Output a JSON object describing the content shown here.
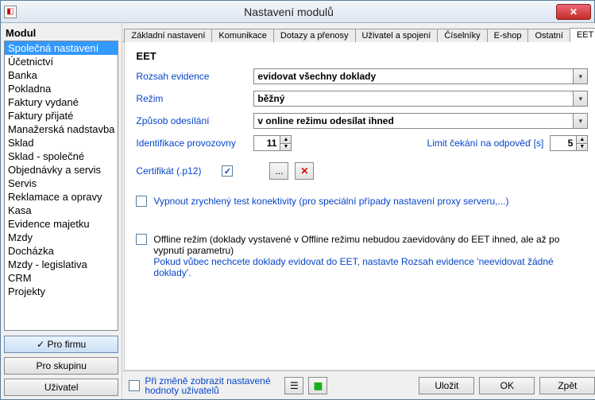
{
  "window": {
    "title": "Nastavení modulů"
  },
  "sidebar": {
    "heading": "Modul",
    "items": [
      "Společná nastavení",
      "Účetnictví",
      "Banka",
      "Pokladna",
      "Faktury vydané",
      "Faktury přijaté",
      "Manažerská nadstavba",
      "Sklad",
      "Sklad - společné",
      "Objednávky a servis",
      "Servis",
      "Reklamace a opravy",
      "Kasa",
      "Evidence majetku",
      "Mzdy",
      "Docházka",
      "Mzdy - legislativa",
      "CRM",
      "Projekty"
    ],
    "selected_index": 0,
    "buttons": {
      "firm": "✓ Pro firmu",
      "group": "Pro skupinu",
      "user": "Uživatel"
    }
  },
  "tabs": [
    "Základní nastavení",
    "Komunikace",
    "Dotazy a přenosy",
    "Uživatel a spojení",
    "Číselníky",
    "E-shop",
    "Ostatní",
    "EET"
  ],
  "active_tab_index": 7,
  "eet": {
    "title": "EET",
    "rozsah_label": "Rozsah evidence",
    "rozsah_value": "evidovat všechny doklady",
    "rezim_label": "Režim",
    "rezim_value": "běžný",
    "zpusob_label": "Způsob odesílání",
    "zpusob_value": "v online režimu odesílat ihned",
    "ident_label": "Identifikace provozovny",
    "ident_value": "11",
    "limit_label": "Limit čekání na odpověď [s]",
    "limit_value": "5",
    "cert_label": "Certifikát (.p12)",
    "cert_checked": true,
    "browse_label": "...",
    "chk_test_label": "Vypnout zrychlený test konektivity (pro speciální případy nastavení proxy serveru,...)",
    "chk_offline_label": "Offline režim (doklady vystavené v Offline režimu nebudou zaevidovány do EET ihned, ale až po vypnutí parametru)",
    "offline_hint": "Pokud vůbec nechcete doklady evidovat do EET, nastavte Rozsah evidence 'neevidovat žádné doklady'."
  },
  "footer": {
    "show_changed_label": "Při změně zobrazit nastavené hodnoty uživatelů",
    "save": "Uložit",
    "ok": "OK",
    "back": "Zpět"
  }
}
